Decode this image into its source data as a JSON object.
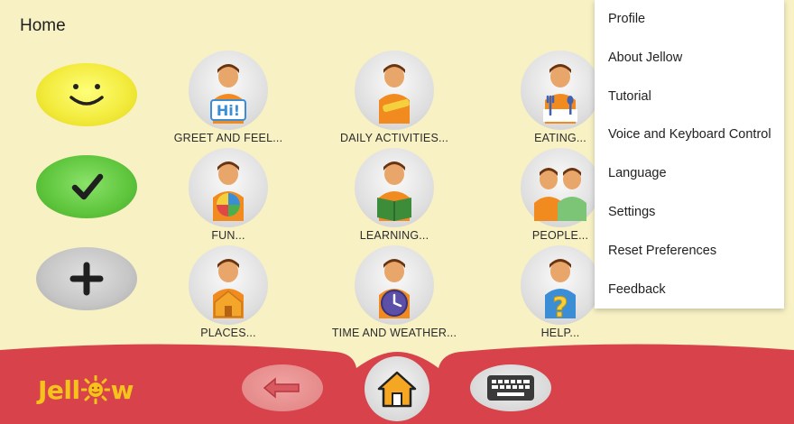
{
  "header": {
    "title": "Home"
  },
  "expressive": [
    {
      "name": "like",
      "icon": "smiley-icon"
    },
    {
      "name": "yes",
      "icon": "checkmark-icon"
    },
    {
      "name": "more",
      "icon": "plus-icon"
    }
  ],
  "categories": [
    {
      "label": "GREET AND FEEL...",
      "icon": "greet-boy-icon"
    },
    {
      "label": "DAILY ACTIVITIES...",
      "icon": "daily-activities-boy-icon"
    },
    {
      "label": "EATING...",
      "icon": "eating-boy-icon"
    },
    {
      "label": "FUN...",
      "icon": "fun-ball-boy-icon"
    },
    {
      "label": "LEARNING...",
      "icon": "learning-book-boy-icon"
    },
    {
      "label": "PEOPLE...",
      "icon": "people-two-boys-icon"
    },
    {
      "label": "PLACES...",
      "icon": "places-house-boy-icon"
    },
    {
      "label": "TIME AND WEATHER...",
      "icon": "time-clock-boy-icon"
    },
    {
      "label": "HELP...",
      "icon": "help-question-boy-icon"
    }
  ],
  "menu": {
    "items": [
      "Profile",
      "About Jellow",
      "Tutorial",
      "Voice and Keyboard Control",
      "Language",
      "Settings",
      "Reset Preferences",
      "Feedback"
    ]
  },
  "bottom": {
    "logo_text_left": "Jell",
    "logo_text_right": "w",
    "back_icon": "back-arrow-icon",
    "home_icon": "home-icon",
    "keyboard_icon": "keyboard-icon"
  },
  "colors": {
    "background": "#f8f1c4",
    "bottom_bar": "#d7424b",
    "logo": "#f6c21c",
    "home_house": "#f5a623"
  }
}
